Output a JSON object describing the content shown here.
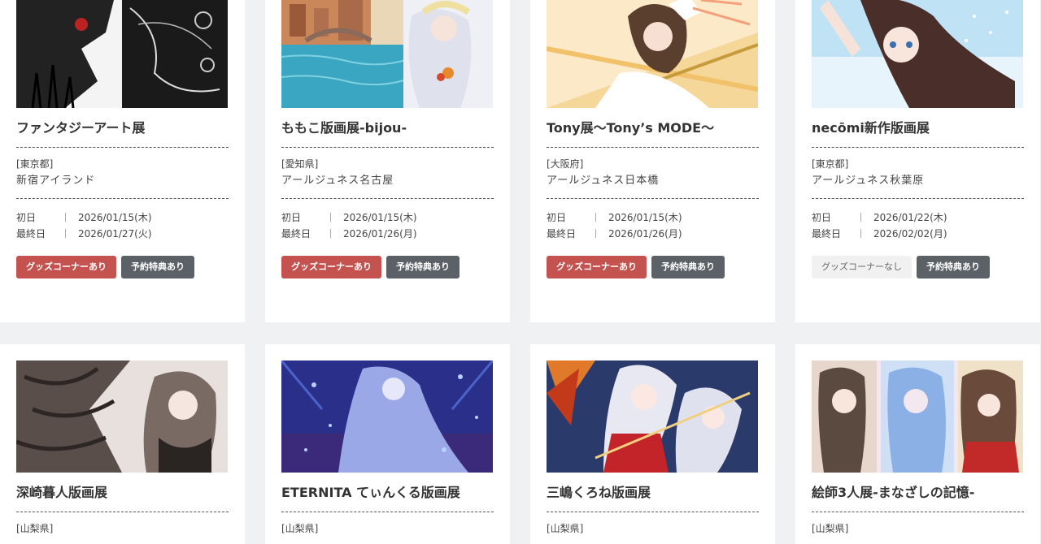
{
  "cards": [
    {
      "title": "ファンタジーアート展",
      "prefecture": "[東京都]",
      "venue": "新宿アイランド",
      "first_day_label": "初日",
      "first_day": "2026/01/15(木)",
      "last_day_label": "最終日",
      "last_day": "2026/01/27(火)",
      "badge_goods": "グッズコーナーあり",
      "badge_goods_style": "red",
      "badge_reserve": "予約特典あり"
    },
    {
      "title": "ももこ版画展-bijou-",
      "prefecture": "[愛知県]",
      "venue": "アールジュネス名古屋",
      "first_day_label": "初日",
      "first_day": "2026/01/15(木)",
      "last_day_label": "最終日",
      "last_day": "2026/01/26(月)",
      "badge_goods": "グッズコーナーあり",
      "badge_goods_style": "red",
      "badge_reserve": "予約特典あり"
    },
    {
      "title": "Tony展〜Tony’s MODE〜",
      "prefecture": "[大阪府]",
      "venue": "アールジュネス日本橋",
      "first_day_label": "初日",
      "first_day": "2026/01/15(木)",
      "last_day_label": "最終日",
      "last_day": "2026/01/26(月)",
      "badge_goods": "グッズコーナーあり",
      "badge_goods_style": "red",
      "badge_reserve": "予約特典あり"
    },
    {
      "title": "necōmi新作版画展",
      "prefecture": "[東京都]",
      "venue": "アールジュネス秋葉原",
      "first_day_label": "初日",
      "first_day": "2026/01/22(木)",
      "last_day_label": "最終日",
      "last_day": "2026/02/02(月)",
      "badge_goods": "グッズコーナーなし",
      "badge_goods_style": "light",
      "badge_reserve": "予約特典あり"
    },
    {
      "title": "深崎暮人版画展",
      "prefecture": "[山梨県]"
    },
    {
      "title": "ETERNITA てぃんくる版画展",
      "prefecture": "[山梨県]"
    },
    {
      "title": "三嶋くろね版画展",
      "prefecture": "[山梨県]"
    },
    {
      "title": "絵師3人展-まなざしの記憶-",
      "prefecture": "[山梨県]"
    }
  ],
  "colors": {
    "badge_red": "#c4524f",
    "badge_gray": "#5b6166",
    "badge_light": "#f1f1f1",
    "page_bg": "#f0f1f3"
  }
}
